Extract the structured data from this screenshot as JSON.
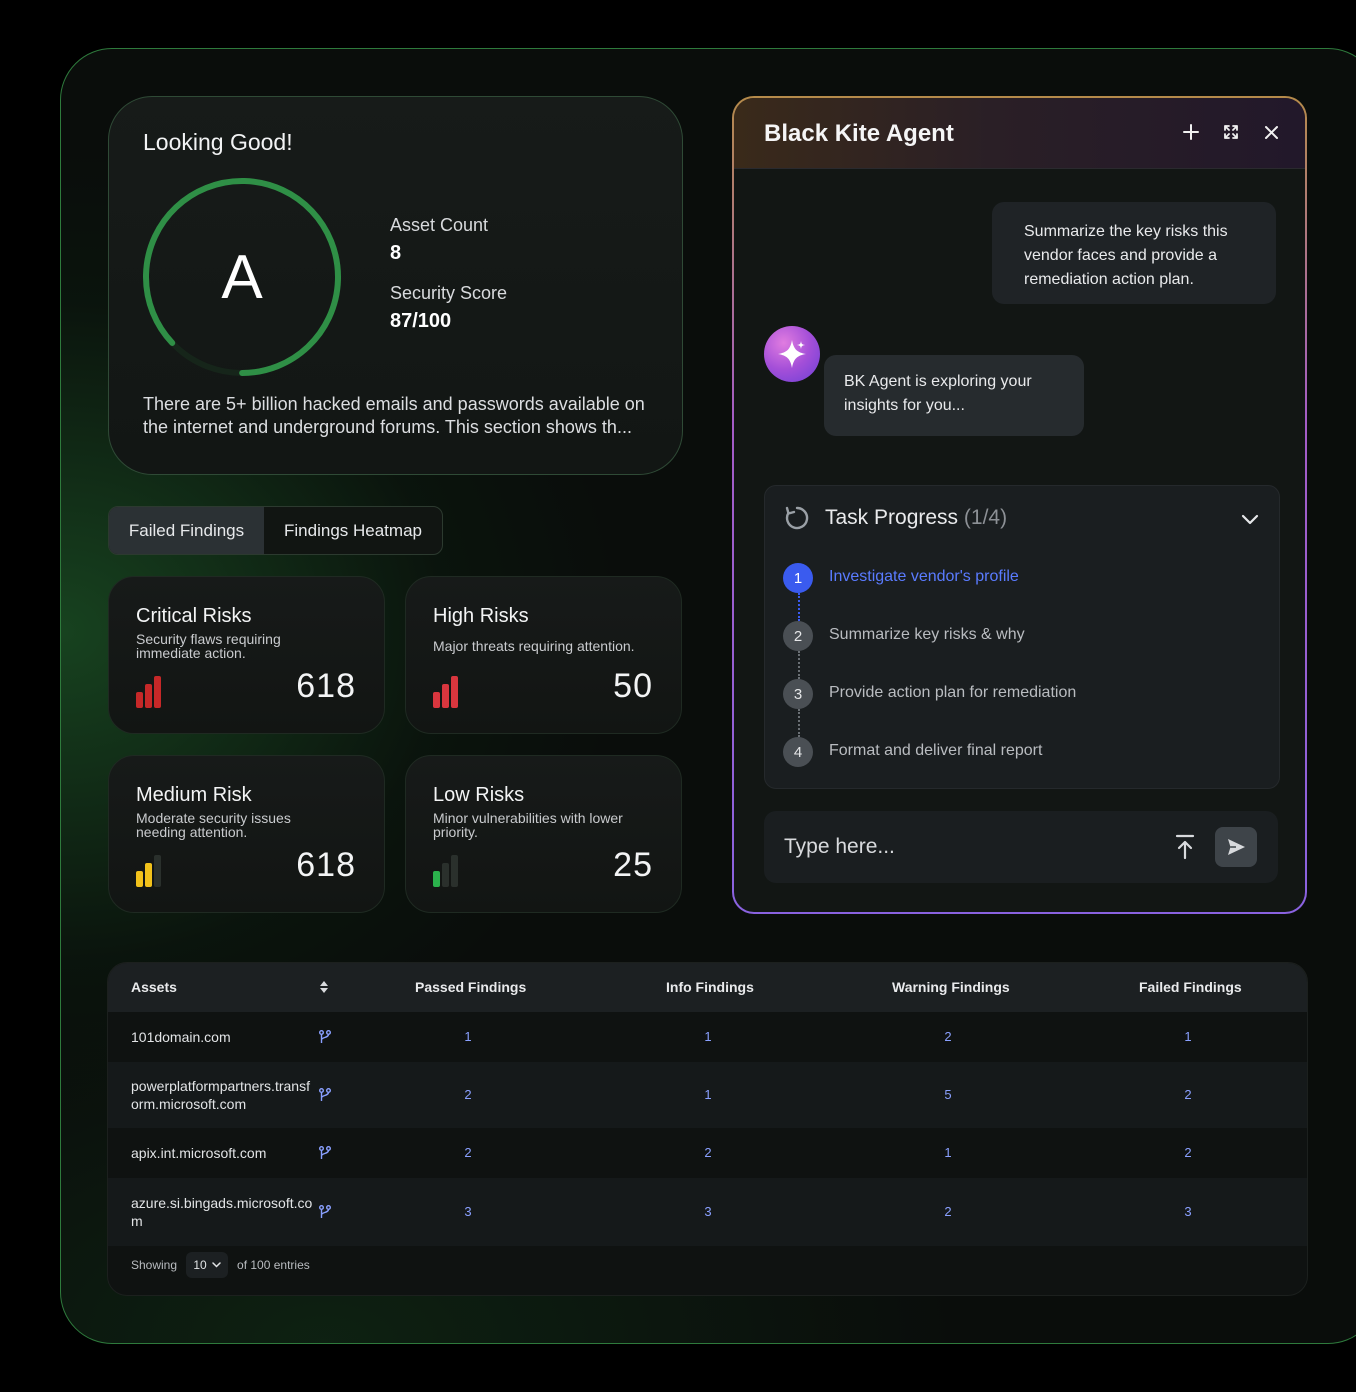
{
  "score_card": {
    "title": "Looking Good!",
    "grade": "A",
    "gauge_fraction": 0.87,
    "asset_count_label": "Asset Count",
    "asset_count_value": "8",
    "security_score_label": "Security Score",
    "security_score_value": "87/100",
    "description": "There are 5+ billion hacked emails and passwords available on the internet and underground forums. This section shows th..."
  },
  "tabs": [
    {
      "label": "Failed Findings",
      "active": true
    },
    {
      "label": "Findings Heatmap",
      "active": false
    }
  ],
  "risks": [
    {
      "title": "Critical Risks",
      "subtitle": "Security flaws requiring immediate action.",
      "value": "618",
      "level": 3,
      "color": "#c62828"
    },
    {
      "title": "High Risks",
      "subtitle": "Major threats requiring attention.",
      "value": "50",
      "level": 3,
      "color": "#d9363e"
    },
    {
      "title": "Medium Risk",
      "subtitle": "Moderate security issues needing attention.",
      "value": "618",
      "level": 2,
      "color": "#f2c21b"
    },
    {
      "title": "Low Risks",
      "subtitle": "Minor vulnerabilities with lower priority.",
      "value": "25",
      "level": 1,
      "color": "#2bb24c"
    }
  ],
  "agent": {
    "title": "Black Kite Agent",
    "header_icons": [
      "plus-icon",
      "expand-icon",
      "close-icon"
    ],
    "user_message": "Summarize the key risks this vendor faces and provide a remediation action plan.",
    "bot_message": "BK Agent is exploring your insights for you...",
    "task_progress_label": "Task Progress",
    "task_progress_count": "(1/4)",
    "steps": [
      {
        "num": "1",
        "text": "Investigate vendor's profile",
        "active": true
      },
      {
        "num": "2",
        "text": "Summarize key risks & why",
        "active": false
      },
      {
        "num": "3",
        "text": "Provide action plan for remediation",
        "active": false
      },
      {
        "num": "4",
        "text": "Format and deliver final report",
        "active": false
      }
    ],
    "input_placeholder": "Type here..."
  },
  "table": {
    "headers": [
      "Assets",
      "Passed Findings",
      "Info Findings",
      "Warning Findings",
      "Failed Findings"
    ],
    "rows": [
      {
        "asset": "101domain.com",
        "passed": "1",
        "info": "1",
        "warning": "2",
        "failed": "1"
      },
      {
        "asset": "powerplatformpartners.transform.microsoft.com",
        "passed": "2",
        "info": "1",
        "warning": "5",
        "failed": "2"
      },
      {
        "asset": "apix.int.microsoft.com",
        "passed": "2",
        "info": "2",
        "warning": "1",
        "failed": "2"
      },
      {
        "asset": "azure.si.bingads.microsoft.com",
        "passed": "3",
        "info": "3",
        "warning": "2",
        "failed": "3"
      }
    ],
    "footer_showing": "Showing",
    "page_size": "10",
    "footer_total": "of 100 entries"
  },
  "colors": {
    "accent_green": "#2f8f46",
    "accent_blue": "#3a5bef",
    "link_blue": "#5a7bff",
    "agent_border_top": "#b58a4a",
    "agent_border_bottom": "#8a62e0"
  }
}
